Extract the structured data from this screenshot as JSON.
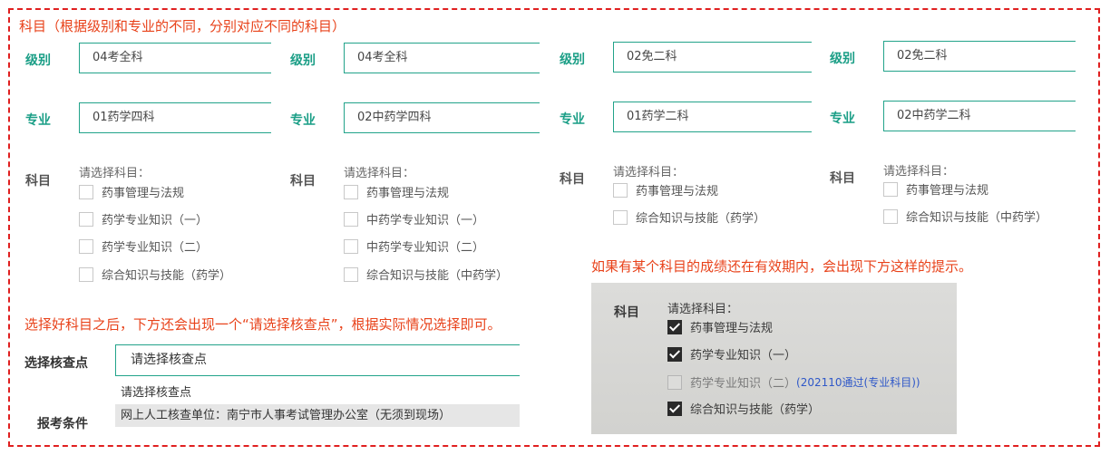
{
  "annotations": {
    "top_note": "科目（根据级别和专业的不同，分别对应不同的科目）",
    "select_note": "选择好科目之后，下方还会出现一个“请选择核查点”，根据实际情况选择即可。",
    "valid_note": "如果有某个科目的成绩还在有效期内，会出现下方这样的提示。"
  },
  "labels": {
    "level": "级别",
    "major": "专业",
    "subject": "科目",
    "choose_check_point": "选择核查点",
    "exam_conditions": "报考条件"
  },
  "columns": [
    {
      "level": "04考全科",
      "major": "01药学四科",
      "subject_hint": "请选择科目：",
      "subjects": [
        "药事管理与法规",
        "药学专业知识（一）",
        "药学专业知识（二）",
        "综合知识与技能（药学）"
      ]
    },
    {
      "level": "04考全科",
      "major": "02中药学四科",
      "subject_hint": "请选择科目：",
      "subjects": [
        "药事管理与法规",
        "中药学专业知识（一）",
        "中药学专业知识（二）",
        "综合知识与技能（中药学）"
      ]
    },
    {
      "level": "02免二科",
      "major": "01药学二科",
      "subject_hint": "请选择科目：",
      "subjects": [
        "药事管理与法规",
        "综合知识与技能（药学）"
      ]
    },
    {
      "level": "02免二科",
      "major": "02中药学二科",
      "subject_hint": "请选择科目：",
      "subjects": [
        "药事管理与法规",
        "综合知识与技能（中药学）"
      ]
    }
  ],
  "check_point": {
    "value": "请选择核查点",
    "options": [
      "请选择核查点",
      "网上人工核查单位：南宁市人事考试管理办公室（无须到现场）"
    ],
    "highlighted_index": 1
  },
  "photo": {
    "label": "科目",
    "hint": "请选择科目：",
    "items": [
      {
        "text": "药事管理与法规",
        "checked": true
      },
      {
        "text": "药学专业知识（一）",
        "checked": true
      },
      {
        "text": "药学专业知识（二）",
        "checked": false,
        "note": "(202110通过(专业科目))"
      },
      {
        "text": "综合知识与技能（药学）",
        "checked": true
      }
    ]
  },
  "colors": {
    "accent_green": "#1a9e86",
    "annotation_red": "#e8421a",
    "frame_red": "#e02020",
    "note_blue": "#2f58c8"
  }
}
